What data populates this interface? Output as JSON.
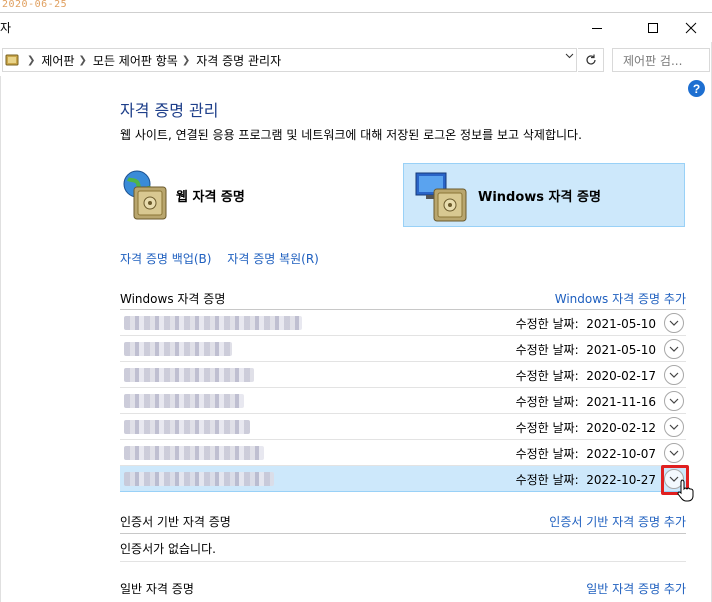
{
  "datestamp": "2020-06-25",
  "window": {
    "title": "자"
  },
  "address": {
    "crumbs": [
      "제어판",
      "모든 제어판 항목",
      "자격 증명 관리자"
    ],
    "search_placeholder": "제어판 검..."
  },
  "help_label": "?",
  "heading": "자격 증명 관리",
  "subtitle": "웹 사이트, 연결된 응용 프로그램 및 네트워크에 대해 저장된 로그온 정보를 보고 삭제합니다.",
  "vaults": {
    "web": {
      "label": "웹 자격 증명"
    },
    "windows": {
      "label": "Windows 자격 증명",
      "selected": true
    }
  },
  "links": {
    "backup": "자격 증명 백업(B)",
    "restore": "자격 증명 복원(R)"
  },
  "windows_section": {
    "title": "Windows 자격 증명",
    "add_link": "Windows 자격 증명 추가",
    "rows": [
      {
        "date_label": "수정한 날짜:  2021-05-10",
        "selected": false
      },
      {
        "date_label": "수정한 날짜:  2021-05-10",
        "selected": false
      },
      {
        "date_label": "수정한 날짜:  2020-02-17",
        "selected": false
      },
      {
        "date_label": "수정한 날짜:  2021-11-16",
        "selected": false
      },
      {
        "date_label": "수정한 날짜:  2020-02-12",
        "selected": false
      },
      {
        "date_label": "수정한 날짜:  2022-10-07",
        "selected": false
      },
      {
        "date_label": "수정한 날짜:  2022-10-27",
        "selected": true
      }
    ]
  },
  "cert_section": {
    "title": "인증서 기반 자격 증명",
    "add_link": "인증서 기반 자격 증명 추가",
    "empty": "인증서가 없습니다."
  },
  "generic_section": {
    "title": "일반 자격 증명",
    "add_link": "일반 자격 증명 추가"
  },
  "colors": {
    "accent": "#1e5fbf",
    "heading": "#1e3f8a",
    "selected_bg": "#cde8fb",
    "highlight": "#e02020"
  }
}
